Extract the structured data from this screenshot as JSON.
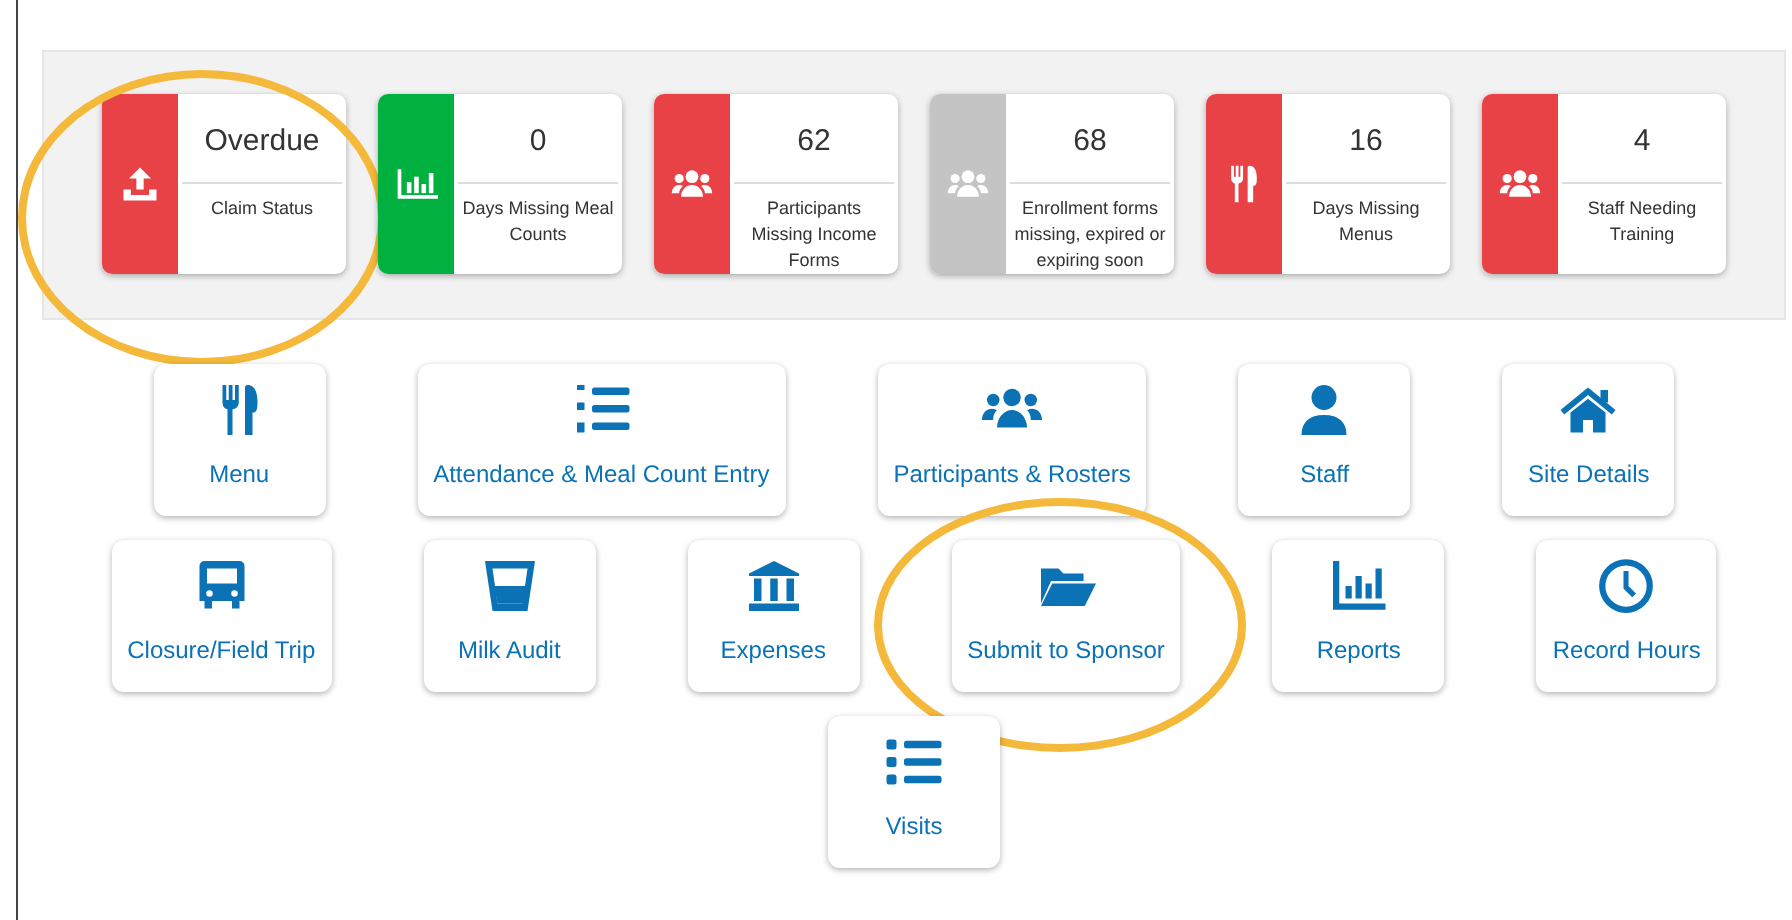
{
  "status_cards": [
    {
      "color": "#e84146",
      "value": "Overdue",
      "label": "Claim Status",
      "circled": true
    },
    {
      "color": "#00b140",
      "value": "0",
      "label": "Days Missing Meal Counts",
      "circled": false
    },
    {
      "color": "#e84146",
      "value": "62",
      "label": "Participants Missing Income Forms",
      "circled": false
    },
    {
      "color": "#c4c4c4",
      "value": "68",
      "label": "Enrollment forms missing, expired or expiring soon",
      "circled": false
    },
    {
      "color": "#e84146",
      "value": "16",
      "label": "Days Missing Menus",
      "circled": false
    },
    {
      "color": "#e84146",
      "value": "4",
      "label": "Staff Needing Training",
      "circled": false
    }
  ],
  "nav_rows": [
    [
      {
        "label": "Menu",
        "circled": false
      },
      {
        "label": "Attendance & Meal Count Entry",
        "circled": false
      },
      {
        "label": "Participants & Rosters",
        "circled": false
      },
      {
        "label": "Staff",
        "circled": false
      },
      {
        "label": "Site Details",
        "circled": false
      }
    ],
    [
      {
        "label": "Closure/Field Trip",
        "circled": false
      },
      {
        "label": "Milk Audit",
        "circled": false
      },
      {
        "label": "Expenses",
        "circled": false
      },
      {
        "label": "Submit to Sponsor",
        "circled": true
      },
      {
        "label": "Reports",
        "circled": false
      },
      {
        "label": "Record Hours",
        "circled": false
      }
    ],
    [
      {
        "label": "Visits",
        "circled": false
      }
    ]
  ]
}
